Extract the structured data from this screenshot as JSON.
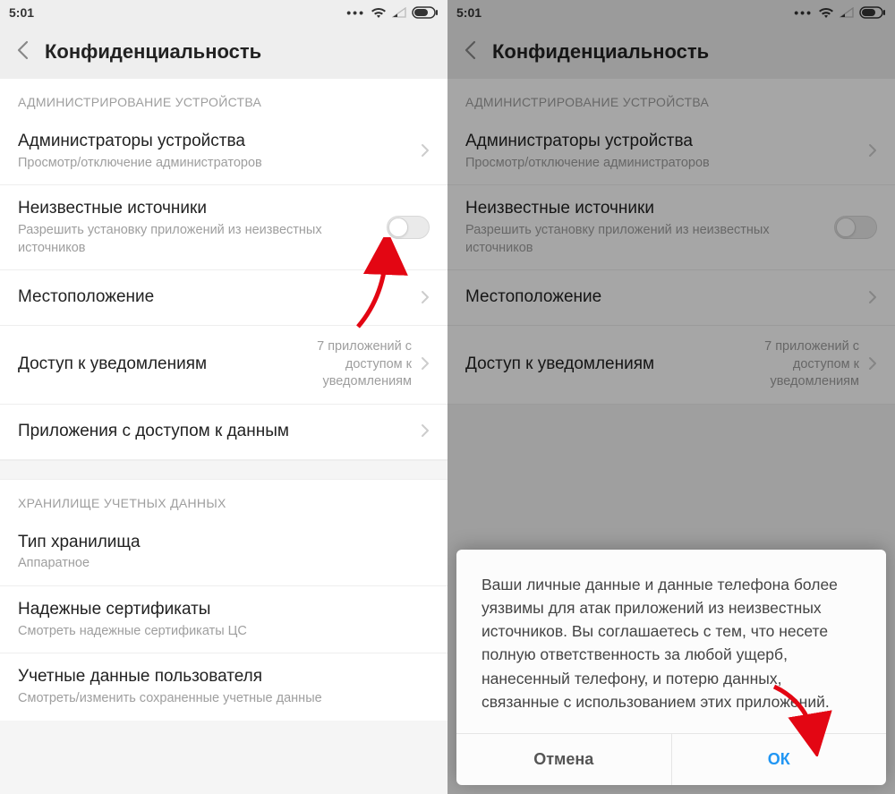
{
  "status": {
    "time": "5:01"
  },
  "header": {
    "title": "Конфиденциальность"
  },
  "sections": {
    "admin_label": "АДМИНИСТРИРОВАНИЕ УСТРОЙСТВА",
    "storage_label": "ХРАНИЛИЩЕ УЧЕТНЫХ ДАННЫХ"
  },
  "rows": {
    "admins": {
      "title": "Администраторы устройства",
      "sub": "Просмотр/отключение администраторов"
    },
    "unknown": {
      "title": "Неизвестные источники",
      "sub": "Разрешить установку приложений из неизвестных источников"
    },
    "location": {
      "title": "Местоположение"
    },
    "notif": {
      "title": "Доступ к уведомлениям",
      "value": "7 приложений с доступом к уведомлениям"
    },
    "data_access": {
      "title": "Приложения с доступом к данным"
    },
    "storage_type": {
      "title": "Тип хранилища",
      "sub": "Аппаратное"
    },
    "trusted_certs": {
      "title": "Надежные сертификаты",
      "sub": "Смотреть надежные сертификаты ЦС"
    },
    "user_creds": {
      "title": "Учетные данные пользователя",
      "sub": "Смотреть/изменить сохраненные учетные данные"
    }
  },
  "dialog": {
    "body": "Ваши личные данные и данные телефона более уязвимы для атак приложений из неизвестных источников. Вы соглашаетесь с тем, что несете полную ответственность за любой ущерб, нанесенный телефону, и потерю данных, связанные с использованием этих приложений.",
    "cancel": "Отмена",
    "ok": "ОК"
  }
}
